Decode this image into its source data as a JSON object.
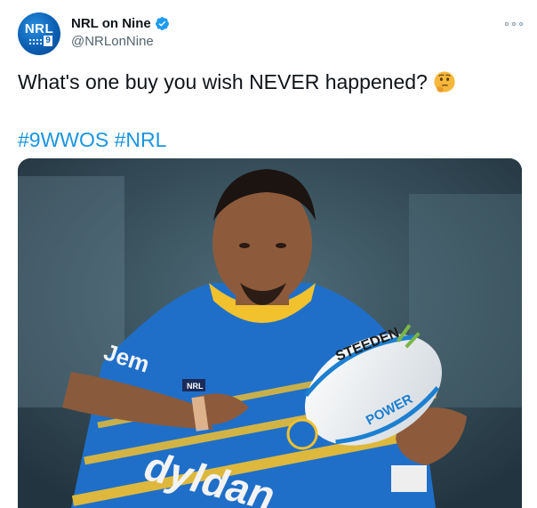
{
  "tweet": {
    "display_name": "NRL on Nine",
    "handle": "@NRLonNine",
    "text": "What's one buy you wish NEVER happened?",
    "hashtags": [
      "#9WWOS",
      "#NRL"
    ],
    "avatar_label": "NRL",
    "avatar_badge": "9",
    "verified": true,
    "emoji": "thinking-face"
  },
  "media": {
    "ball_text_1": "STEEDEN",
    "ball_text_2": "POWER",
    "jersey_text": "dyldan",
    "jersey_sleeve": "Jem",
    "badge_text": "NRL"
  },
  "colors": {
    "link": "#1b95e0",
    "verified": "#1d9bf0",
    "jersey_blue": "#1f6fc9",
    "jersey_gold": "#f2c12e"
  }
}
